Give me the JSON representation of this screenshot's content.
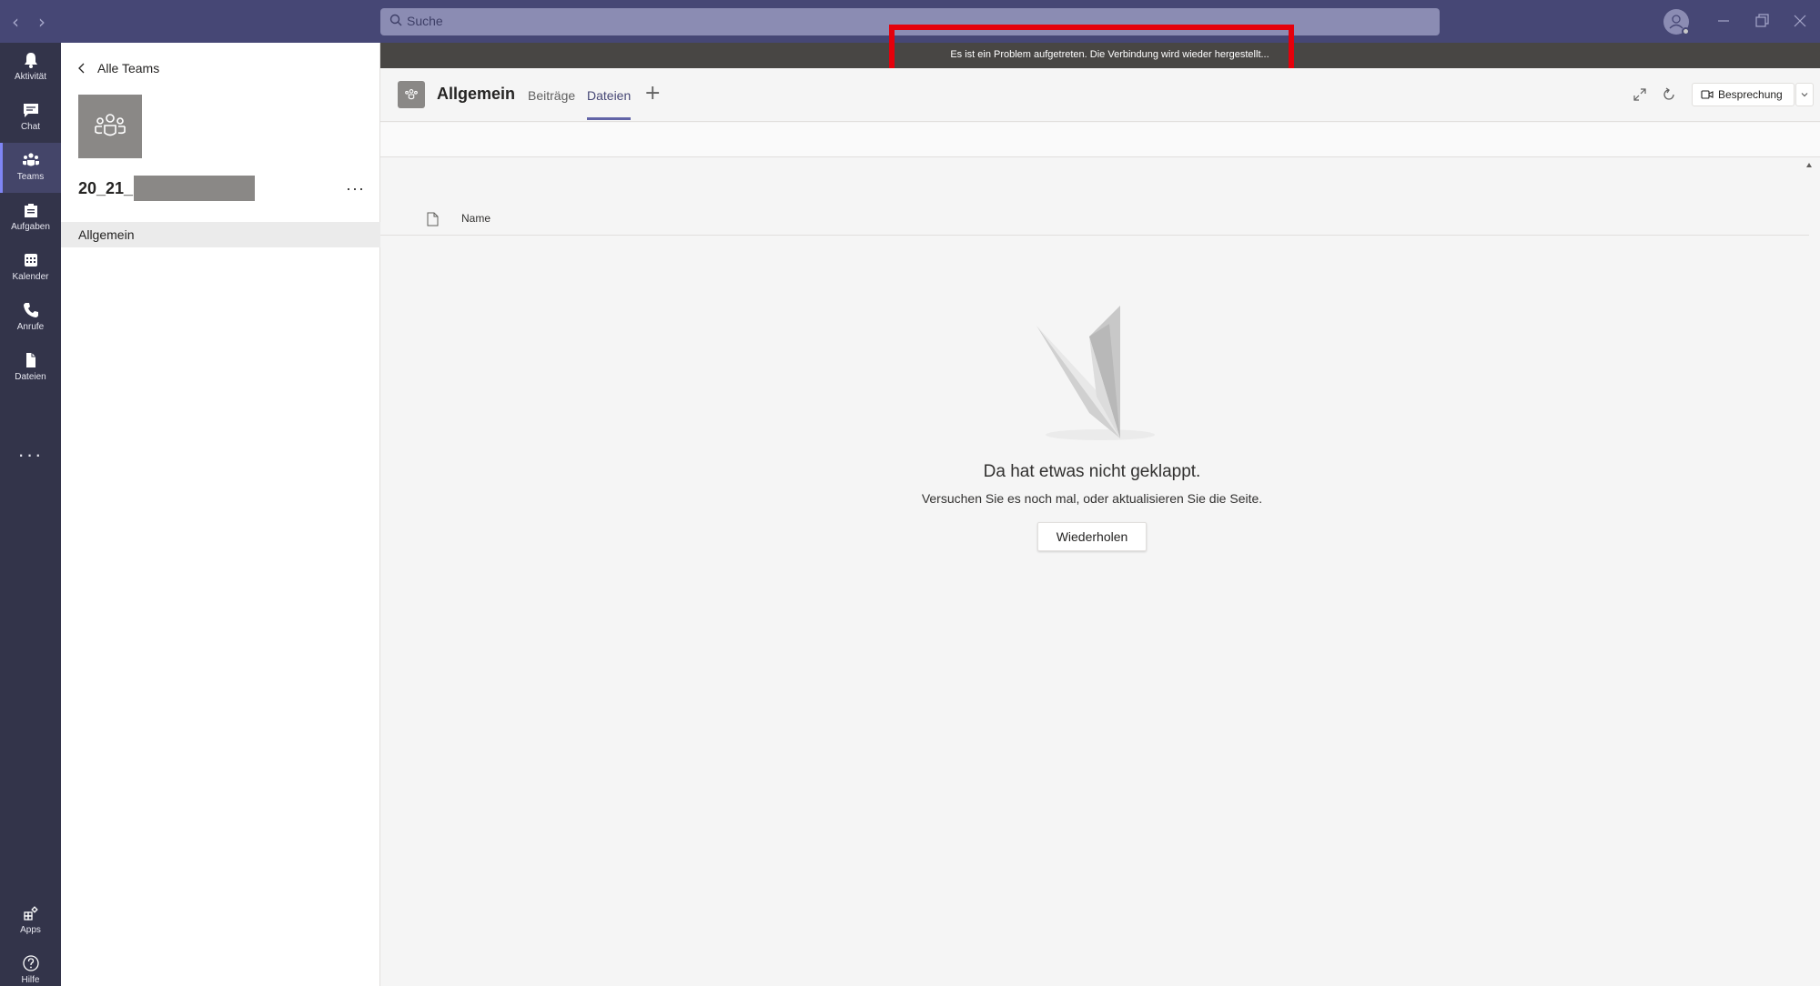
{
  "titlebar": {
    "search_placeholder": "Suche"
  },
  "rail": {
    "items": [
      {
        "label": "Aktivität",
        "icon": "bell-icon"
      },
      {
        "label": "Chat",
        "icon": "chat-icon"
      },
      {
        "label": "Teams",
        "icon": "teams-icon"
      },
      {
        "label": "Aufgaben",
        "icon": "tasks-icon"
      },
      {
        "label": "Kalender",
        "icon": "calendar-icon"
      },
      {
        "label": "Anrufe",
        "icon": "phone-icon"
      },
      {
        "label": "Dateien",
        "icon": "file-icon"
      }
    ],
    "more": "···",
    "bottom": [
      {
        "label": "Apps",
        "icon": "apps-icon"
      },
      {
        "label": "Hilfe",
        "icon": "help-icon"
      }
    ]
  },
  "teampanel": {
    "back_label": "Alle Teams",
    "team_name": "20_21_",
    "more": "···",
    "channel": "Allgemein"
  },
  "banner": {
    "text": "Es ist ein Problem aufgetreten. Die Verbindung wird wieder hergestellt..."
  },
  "channel_header": {
    "title": "Allgemein",
    "tabs": [
      {
        "label": "Beiträge",
        "active": false
      },
      {
        "label": "Dateien",
        "active": true
      }
    ],
    "add": "+",
    "meeting_label": "Besprechung"
  },
  "files": {
    "column_name": "Name",
    "error_title": "Da hat etwas nicht geklappt.",
    "error_subtitle": "Versuchen Sie es noch mal, oder aktualisieren Sie die Seite.",
    "retry_label": "Wiederholen"
  },
  "colors": {
    "titlebar": "#464775",
    "rail": "#33344a",
    "accent": "#6264a7",
    "banner": "#484644",
    "highlight": "#e5000b"
  }
}
